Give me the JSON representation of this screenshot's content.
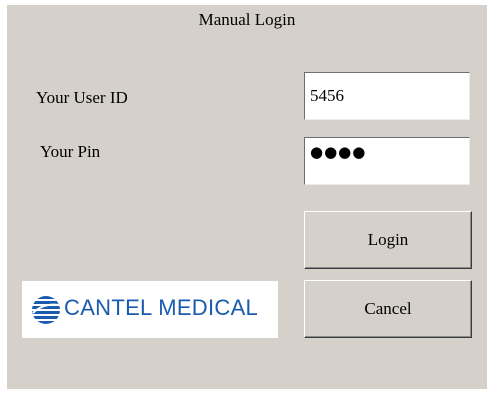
{
  "window": {
    "title": "Manual Login"
  },
  "form": {
    "user_id_label": "Your User ID",
    "user_id_value": "5456",
    "pin_label": "Your Pin",
    "pin_masked": "●●●●"
  },
  "buttons": {
    "login_label": "Login",
    "cancel_label": "Cancel"
  },
  "logo": {
    "text": "CANTEL MEDICAL",
    "icon": "cantel-medical-logo-icon",
    "brand_color": "#1a5bb0"
  },
  "colors": {
    "panel_background": "#d5d0c9",
    "field_background": "#ffffff"
  }
}
